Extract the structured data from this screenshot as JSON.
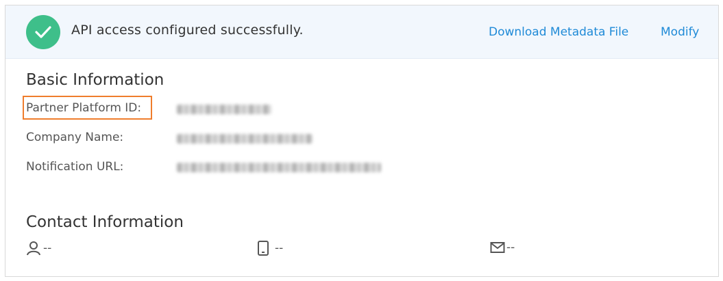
{
  "banner": {
    "message": "API access configured successfully.",
    "download_link": "Download Metadata File",
    "modify_link": "Modify",
    "accent_color": "#3ebf8a",
    "link_color": "#1f8ad7"
  },
  "basic_info": {
    "title": "Basic Information",
    "fields": [
      {
        "label": "Partner Platform ID:",
        "value_redacted": true
      },
      {
        "label": "Company Name:",
        "value_redacted": true
      },
      {
        "label": "Notification URL:",
        "value_redacted": true
      }
    ],
    "highlight_color": "#ef7d2c"
  },
  "contact_info": {
    "title": "Contact Information",
    "items": [
      {
        "icon": "user-icon",
        "value": "--"
      },
      {
        "icon": "mobile-phone-icon",
        "value": "--"
      },
      {
        "icon": "mail-icon",
        "value": "--"
      }
    ]
  }
}
